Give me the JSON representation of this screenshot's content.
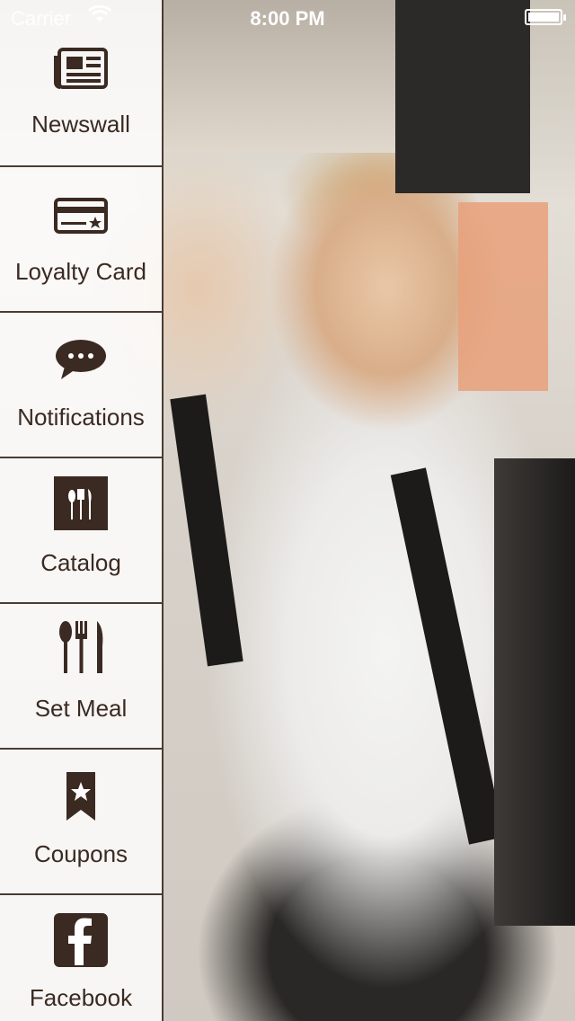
{
  "status_bar": {
    "carrier": "Carrier",
    "time": "8:00 PM"
  },
  "menu": {
    "items": [
      {
        "label": "Newswall",
        "icon": "newspaper-icon"
      },
      {
        "label": "Loyalty Card",
        "icon": "loyalty-card-icon"
      },
      {
        "label": "Notifications",
        "icon": "chat-bubble-icon"
      },
      {
        "label": "Catalog",
        "icon": "cutlery-square-icon"
      },
      {
        "label": "Set Meal",
        "icon": "spoon-fork-knife-icon"
      },
      {
        "label": "Coupons",
        "icon": "bookmark-star-icon"
      },
      {
        "label": "Facebook",
        "icon": "facebook-icon"
      }
    ]
  },
  "colors": {
    "menu_text": "#3b2a22",
    "menu_border": "#4a3c33",
    "menu_background": "rgba(255,255,255,0.82)"
  }
}
